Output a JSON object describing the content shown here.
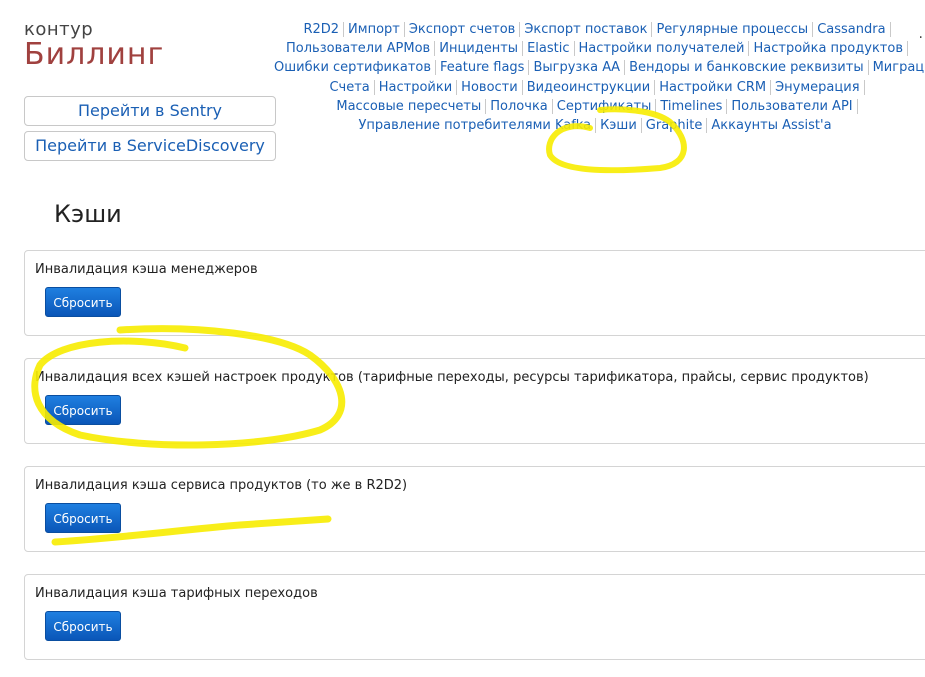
{
  "logo": {
    "top": "контур",
    "main": "Биллинг"
  },
  "side_buttons": {
    "sentry": "Перейти в Sentry",
    "service_discovery": "Перейти в ServiceDiscovery"
  },
  "nav": {
    "rows": [
      [
        "R2D2",
        "Импорт",
        "Экспорт счетов",
        "Экспорт поставок",
        "Регулярные процессы",
        "Cassandra"
      ],
      [
        "Пользователи АРМов",
        "Инциденты",
        "Elastic",
        "Настройки получателей",
        "Настройка продуктов"
      ],
      [
        "Ошибки сертификатов",
        "Feature flags",
        "Выгрузка АА",
        "Вендоры и банковские реквизиты",
        "Миграция"
      ],
      [
        "Счета",
        "Настройки",
        "Новости",
        "Видеоинструкции",
        "Настройки CRM",
        "Энумерация"
      ],
      [
        "Массовые пересчеты",
        "Полочка",
        "Сертификаты",
        "Timelines",
        "Пользователи API"
      ],
      [
        "Управление потребителями Kafka",
        "Кэши",
        "Graphite",
        "Аккаунты Assist'a"
      ]
    ]
  },
  "page_title": "Кэши",
  "panels": [
    {
      "label": "Инвалидация кэша менеджеров",
      "button": "Сбросить"
    },
    {
      "label": "Инвалидация всех кэшей настроек продуктов (тарифные переходы, ресурсы тарификатора, прайсы, сервис продуктов)",
      "button": "Сбросить"
    },
    {
      "label": "Инвалидация кэша сервиса продуктов (то же в R2D2)",
      "button": "Сбросить"
    },
    {
      "label": "Инвалидация кэша тарифных переходов",
      "button": "Сбросить"
    }
  ],
  "corner_mark": "."
}
